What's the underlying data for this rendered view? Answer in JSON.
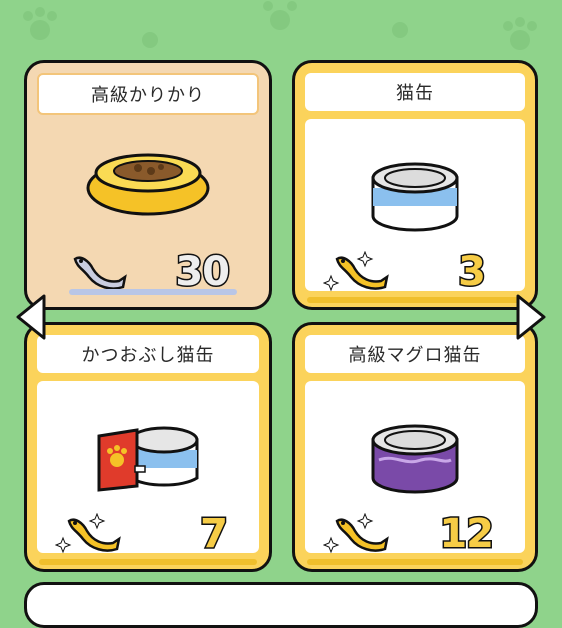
{
  "items": [
    {
      "name": "高級かりかり",
      "price": "30",
      "currency": "silver-fish"
    },
    {
      "name": "猫缶",
      "price": "3",
      "currency": "gold-fish"
    },
    {
      "name": "かつおぶし猫缶",
      "price": "7",
      "currency": "gold-fish"
    },
    {
      "name": "高級マグロ猫缶",
      "price": "12",
      "currency": "gold-fish"
    }
  ],
  "colors": {
    "background": "#8fd38b",
    "card_gold": "#fbd35b",
    "card_owned": "#f4d8b2",
    "outline": "#111111"
  },
  "icons": [
    "silver-fish-icon",
    "gold-fish-icon",
    "left-arrow-icon",
    "right-arrow-icon"
  ]
}
